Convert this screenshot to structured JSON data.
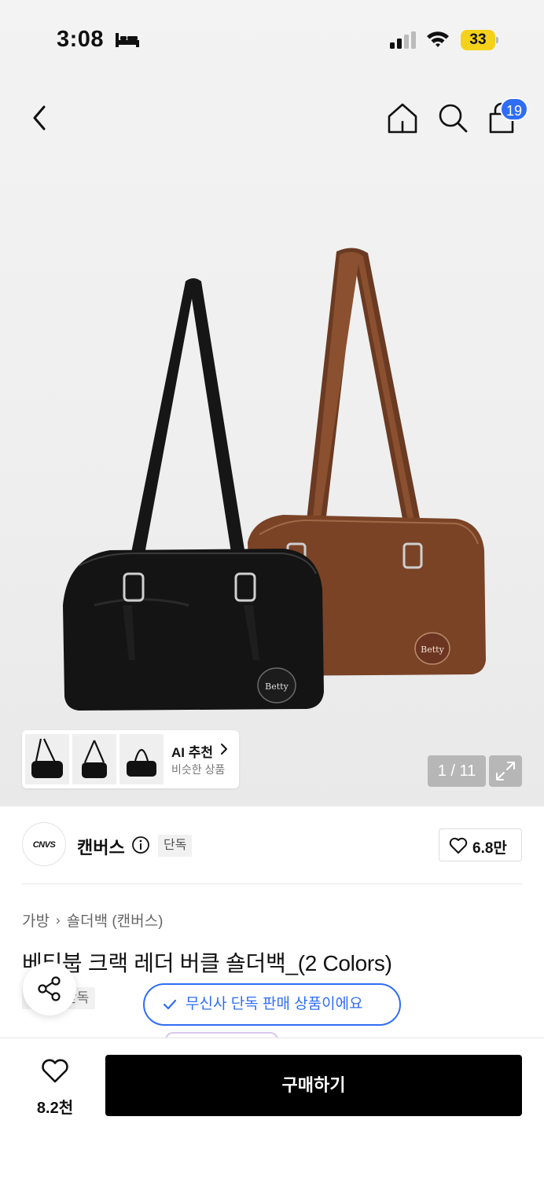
{
  "status_bar": {
    "time": "3:08",
    "battery": "33"
  },
  "nav": {
    "cart_count": "19"
  },
  "gallery": {
    "ai_title": "AI 추천",
    "ai_subtitle": "비슷한 상품",
    "page_counter": "1 / 11"
  },
  "brand": {
    "logo_text": "CNVS",
    "name": "캔버스",
    "tag": "단독",
    "like_count": "6.8만"
  },
  "breadcrumb": {
    "category": "가방",
    "subcategory": "숄더백 (캔버스)"
  },
  "product": {
    "title": "베티붑 크랙 레더 버클 숄더백_(2 Colors)",
    "tag": "단독"
  },
  "toast": {
    "text": "무신사 단독 판매 상품이에요"
  },
  "bottom_bar": {
    "wish_count": "8.2천",
    "buy_label": "구매하기"
  },
  "colors": {
    "accent": "#2f6df5",
    "battery": "#f5d21a",
    "buy": "#000000"
  }
}
